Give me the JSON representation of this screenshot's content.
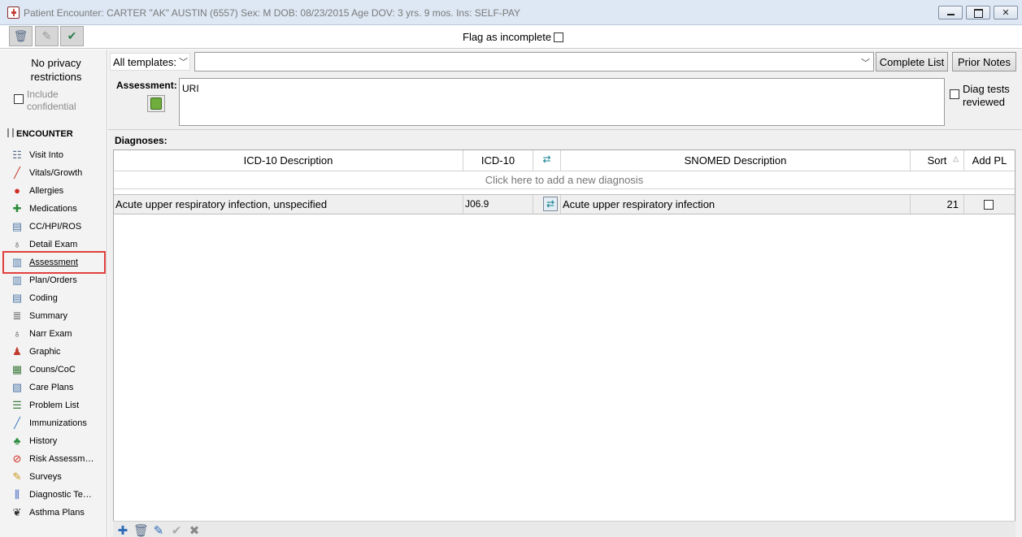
{
  "window": {
    "title": "Patient Encounter: CARTER \"AK\" AUSTIN (6557)  Sex: M  DOB: 08/23/2015  Age DOV: 3 yrs. 9 mos.  Ins: SELF-PAY"
  },
  "toolbar": {
    "flag_label": "Flag as incomplete"
  },
  "sidebar": {
    "privacy": "No privacy restrictions",
    "include_confidential": "Include confidential",
    "section": "ENCOUNTER",
    "items": [
      {
        "label": "Visit Into",
        "icon": "clipboard-icon",
        "glyph": "☷",
        "color": "#5a6d8a"
      },
      {
        "label": "Vitals/Growth",
        "icon": "thermometer-icon",
        "glyph": "╱",
        "color": "#c0392b"
      },
      {
        "label": "Allergies",
        "icon": "allergy-icon",
        "glyph": "●",
        "color": "#d02a22"
      },
      {
        "label": "Medications",
        "icon": "medication-icon",
        "glyph": "✚",
        "color": "#2a8a3a"
      },
      {
        "label": "CC/HPI/ROS",
        "icon": "form-icon",
        "glyph": "▤",
        "color": "#4f78a8"
      },
      {
        "label": "Detail Exam",
        "icon": "stethoscope-icon",
        "glyph": "♁",
        "color": "#444444"
      },
      {
        "label": "Assessment",
        "icon": "open-book-icon",
        "glyph": "▥",
        "color": "#4f78a8",
        "active": true
      },
      {
        "label": "Plan/Orders",
        "icon": "open-book-icon",
        "glyph": "▥",
        "color": "#4f78a8"
      },
      {
        "label": "Coding",
        "icon": "document-icon",
        "glyph": "▤",
        "color": "#4f78a8"
      },
      {
        "label": "Summary",
        "icon": "summary-icon",
        "glyph": "≣",
        "color": "#555555"
      },
      {
        "label": "Narr Exam",
        "icon": "stethoscope-icon",
        "glyph": "♁",
        "color": "#444444"
      },
      {
        "label": "Graphic",
        "icon": "body-figure-icon",
        "glyph": "♟",
        "color": "#c0392b"
      },
      {
        "label": "Couns/CoC",
        "icon": "chart-icon",
        "glyph": "▦",
        "color": "#3f7a3f"
      },
      {
        "label": "Care Plans",
        "icon": "care-plan-icon",
        "glyph": "▧",
        "color": "#4f78a8"
      },
      {
        "label": "Problem List",
        "icon": "list-icon",
        "glyph": "☰",
        "color": "#3f7a3f"
      },
      {
        "label": "Immunizations",
        "icon": "syringe-icon",
        "glyph": "╱",
        "color": "#3b7bbd"
      },
      {
        "label": "History",
        "icon": "family-tree-icon",
        "glyph": "♣",
        "color": "#2a8a3a"
      },
      {
        "label": "Risk Assessm…",
        "icon": "no-symbol-icon",
        "glyph": "⊘",
        "color": "#d02a22"
      },
      {
        "label": "Surveys",
        "icon": "survey-icon",
        "glyph": "✎",
        "color": "#c9961a"
      },
      {
        "label": "Diagnostic Te…",
        "icon": "test-tubes-icon",
        "glyph": "⫼",
        "color": "#3b5fbd"
      },
      {
        "label": "Asthma Plans",
        "icon": "lungs-icon",
        "glyph": "❦",
        "color": "#333333"
      }
    ]
  },
  "main": {
    "template_select": "All templates:",
    "complete_list": "Complete List",
    "prior_notes": "Prior Notes",
    "assessment_label": "Assessment:",
    "assessment_text": "URI",
    "diag_tests_reviewed": "Diag tests reviewed",
    "diagnoses_label": "Diagnoses:",
    "grid": {
      "headers": {
        "icd_desc": "ICD-10 Description",
        "icd": "ICD-10",
        "snomed": "SNOMED Description",
        "sort": "Sort",
        "add_pl": "Add PL"
      },
      "add_row": "Click here to add a new diagnosis",
      "rows": [
        {
          "icd_desc": "Acute upper respiratory infection, unspecified",
          "icd": "J06.9",
          "snomed": "Acute upper respiratory infection",
          "sort": "21",
          "add_pl": false
        }
      ]
    }
  }
}
